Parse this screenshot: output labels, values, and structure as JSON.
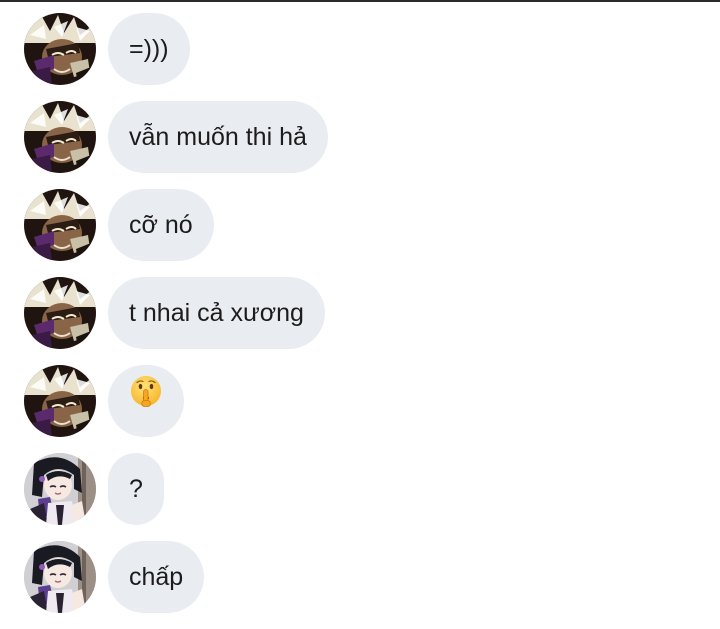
{
  "messages": [
    {
      "sender": "user-a",
      "text": "=)))"
    },
    {
      "sender": "user-a",
      "text": "vẫn muốn thi hả"
    },
    {
      "sender": "user-a",
      "text": "cỡ nó"
    },
    {
      "sender": "user-a",
      "text": "t nhai cả xương"
    },
    {
      "sender": "user-a",
      "text": "",
      "emoji": "shushing-face-emoji"
    },
    {
      "sender": "user-b",
      "text": "?"
    },
    {
      "sender": "user-b",
      "text": "chấp"
    }
  ],
  "colors": {
    "bubble_background": "#e9ecf1",
    "text": "#1c1c1c",
    "page_background": "#ffffff"
  }
}
